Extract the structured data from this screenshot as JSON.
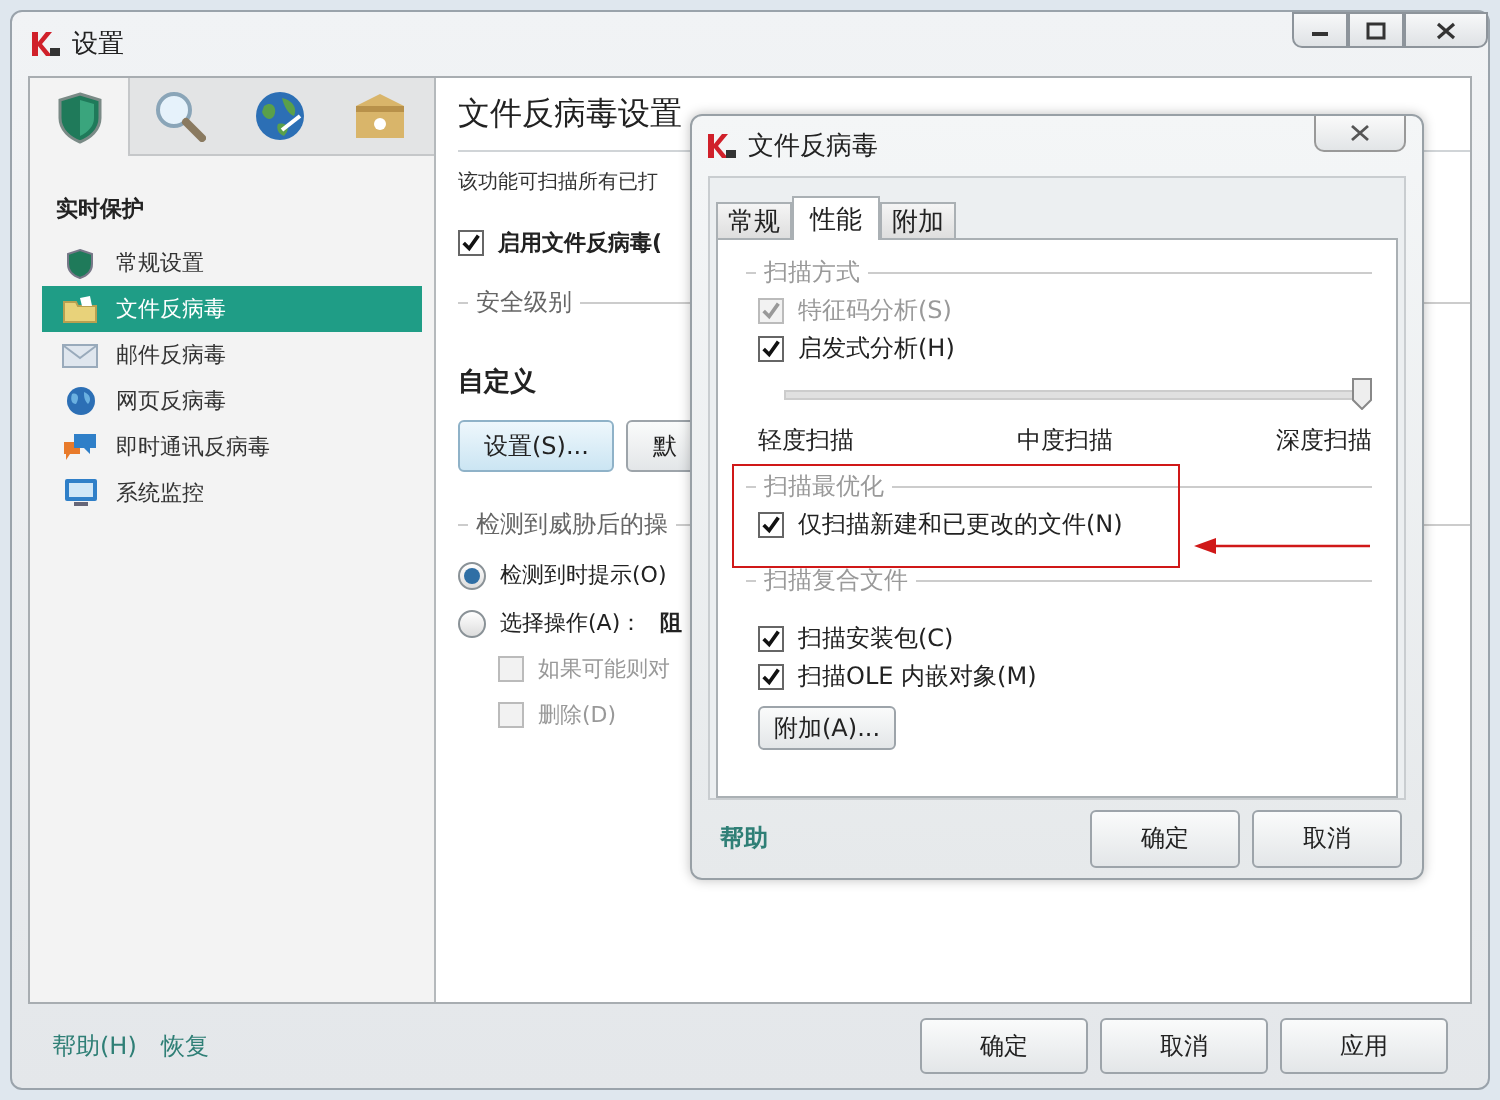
{
  "window": {
    "title": "设置"
  },
  "nav_tabs": [
    {
      "selected": true
    },
    {
      "selected": false
    },
    {
      "selected": false
    },
    {
      "selected": false
    }
  ],
  "sidebar": {
    "heading": "实时保护",
    "items": [
      {
        "label": "常规设置",
        "selected": false
      },
      {
        "label": "文件反病毒",
        "selected": true
      },
      {
        "label": "邮件反病毒",
        "selected": false
      },
      {
        "label": "网页反病毒",
        "selected": false
      },
      {
        "label": "即时通讯反病毒",
        "selected": false
      },
      {
        "label": "系统监控",
        "selected": false
      }
    ]
  },
  "content": {
    "title": "文件反病毒设置",
    "description": "该功能可扫描所有已打",
    "enable": {
      "label": "启用文件反病毒(",
      "checked": true
    },
    "security_level": {
      "legend": "安全级别",
      "level_name": "自定义",
      "buttons": [
        "设置(S)...",
        "默"
      ]
    },
    "actions": {
      "legend": "检测到威胁后的操",
      "options": [
        {
          "label": "检测到时提示(O)",
          "selected": true
        },
        {
          "label": "选择操作(A)：",
          "selected": false,
          "value": "阻"
        }
      ],
      "sub_options": [
        {
          "label": "如果可能则对",
          "checked": false,
          "disabled": true
        },
        {
          "label": "删除(D)",
          "checked": false,
          "disabled": true
        }
      ]
    }
  },
  "footer": {
    "links": [
      "帮助(H)",
      "恢复"
    ],
    "buttons": [
      "确定",
      "取消",
      "应用"
    ]
  },
  "dialog": {
    "title": "文件反病毒",
    "tabs": [
      {
        "label": "常规",
        "selected": false
      },
      {
        "label": "性能",
        "selected": true
      },
      {
        "label": "附加",
        "selected": false
      }
    ],
    "scan_method": {
      "legend": "扫描方式",
      "options": [
        {
          "label": "特征码分析(S)",
          "checked": true,
          "disabled": true
        },
        {
          "label": "启发式分析(H)",
          "checked": true,
          "disabled": false
        }
      ],
      "slider": {
        "level": 1,
        "labels": [
          "轻度扫描",
          "中度扫描",
          "深度扫描"
        ]
      }
    },
    "optimization": {
      "legend": "扫描最优化",
      "options": [
        {
          "label": "仅扫描新建和已更改的文件(N)",
          "checked": true,
          "disabled": false
        }
      ]
    },
    "compound": {
      "legend": "扫描复合文件",
      "options": [
        {
          "label": "扫描安装包(C)",
          "checked": true,
          "disabled": false
        },
        {
          "label": "扫描OLE 内嵌对象(M)",
          "checked": true,
          "disabled": false
        }
      ],
      "button": "附加(A)..."
    },
    "footer": {
      "link": "帮助",
      "buttons": [
        "确定",
        "取消"
      ]
    }
  }
}
